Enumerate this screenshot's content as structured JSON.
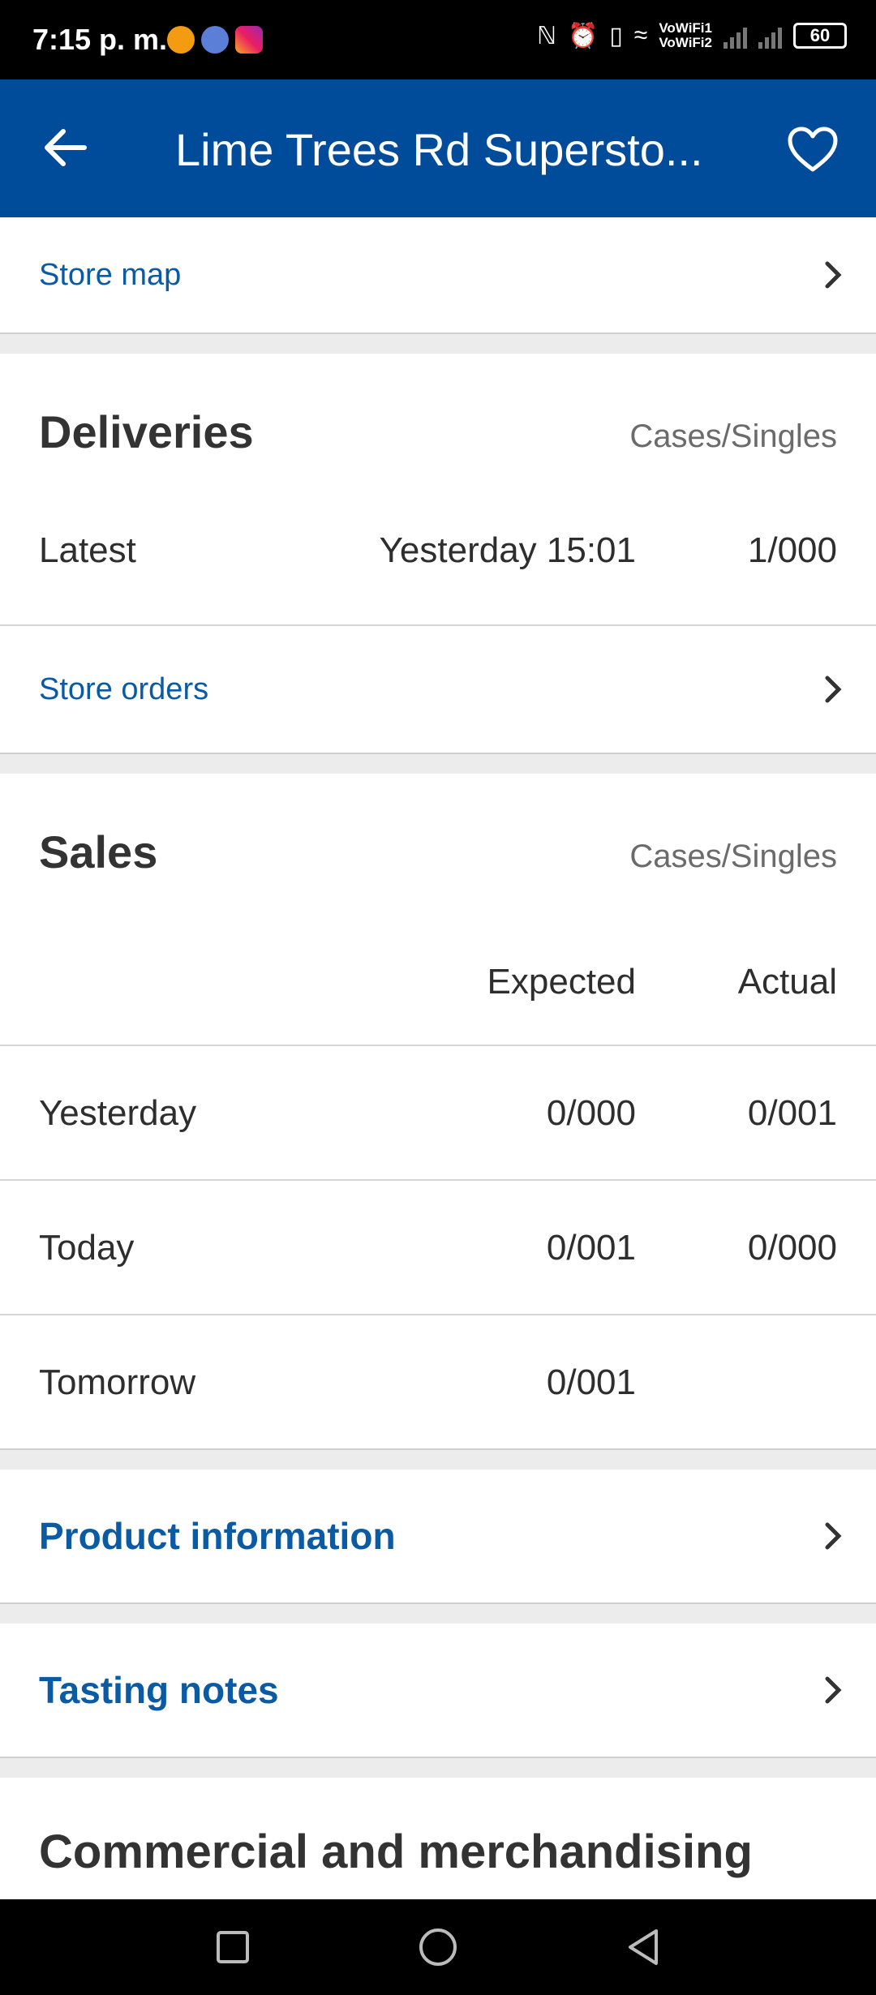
{
  "status_bar": {
    "time": "7:15 p. m.",
    "vowifi_1": "VoWiFi1",
    "vowifi_2": "VoWiFi2",
    "battery": "60"
  },
  "app_bar": {
    "title": "Lime Trees Rd Supersto..."
  },
  "store_map": {
    "label": "Store map"
  },
  "deliveries": {
    "title": "Deliveries",
    "unit": "Cases/Singles",
    "latest": {
      "label": "Latest",
      "time": "Yesterday 15:01",
      "value": "1/000"
    }
  },
  "store_orders": {
    "label": "Store orders"
  },
  "sales": {
    "title": "Sales",
    "unit": "Cases/Singles",
    "columns": {
      "expected": "Expected",
      "actual": "Actual"
    },
    "rows": [
      {
        "label": "Yesterday",
        "expected": "0/000",
        "actual": "0/001"
      },
      {
        "label": "Today",
        "expected": "0/001",
        "actual": "0/000"
      },
      {
        "label": "Tomorrow",
        "expected": "0/001",
        "actual": ""
      }
    ]
  },
  "product_information": {
    "label": "Product information"
  },
  "tasting_notes": {
    "label": "Tasting notes"
  },
  "commercial": {
    "title": "Commercial and merchandising"
  },
  "colors": {
    "brand_blue": "#004c9a",
    "link_blue": "#0a5ba4"
  }
}
